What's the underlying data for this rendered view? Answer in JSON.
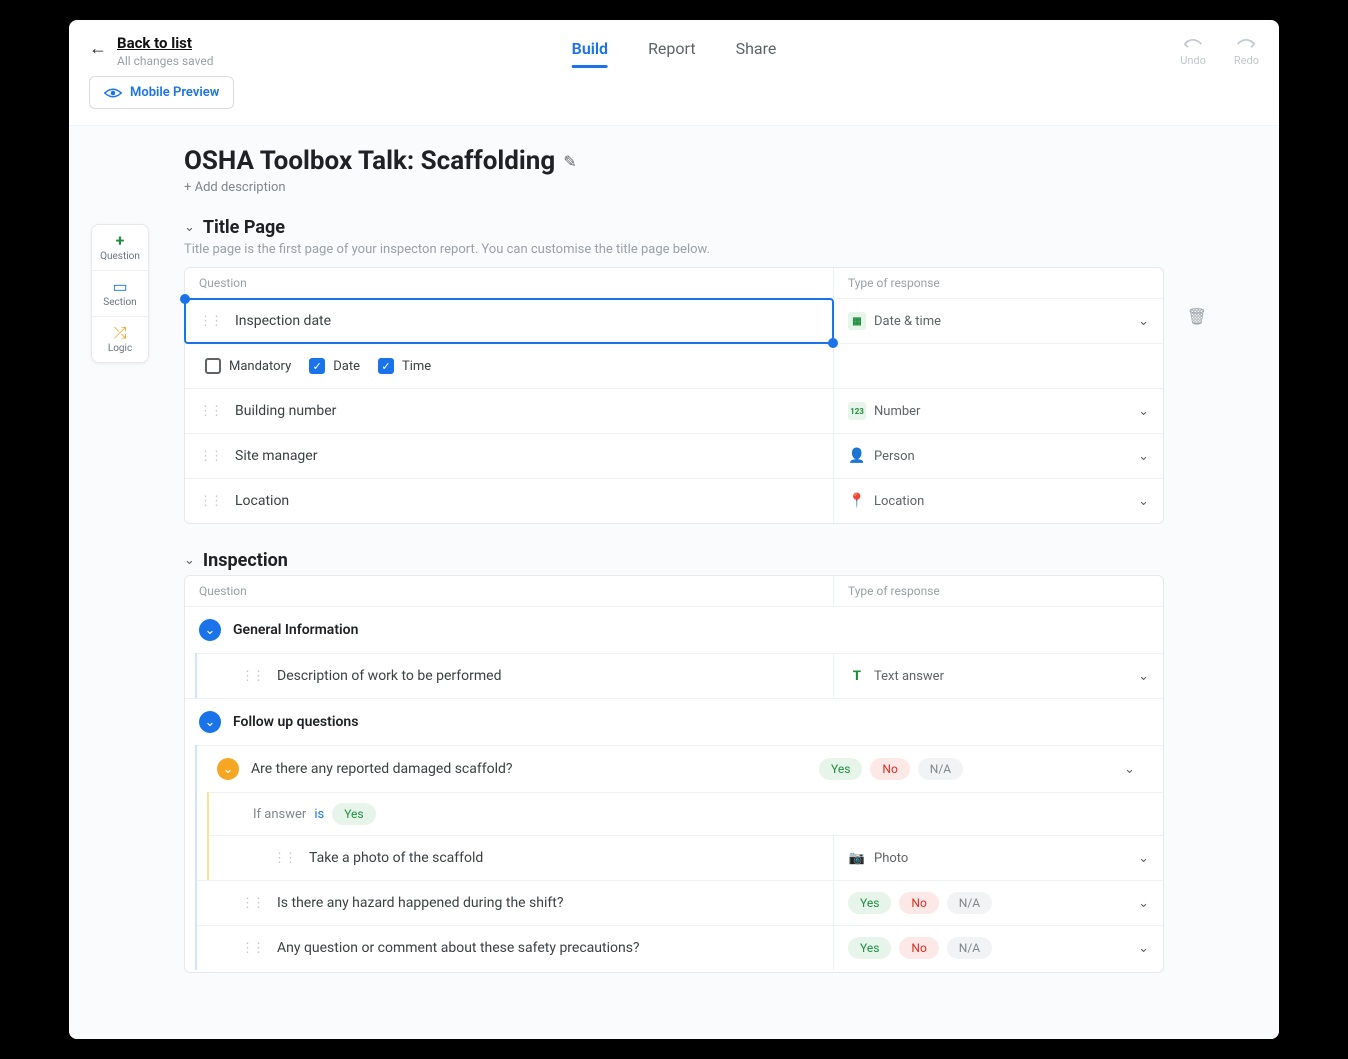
{
  "header": {
    "back_label": "Back to list",
    "saved_text": "All changes saved",
    "tabs": {
      "build": "Build",
      "report": "Report",
      "share": "Share"
    },
    "undo": "Undo",
    "redo": "Redo",
    "mobile_preview": "Mobile Preview"
  },
  "sidetools": {
    "question": "Question",
    "section": "Section",
    "logic": "Logic"
  },
  "template": {
    "title": "OSHA Toolbox Talk: Scaffolding",
    "add_description": "+ Add description"
  },
  "columns": {
    "question": "Question",
    "response": "Type of response"
  },
  "title_page": {
    "name": "Title Page",
    "hint": "Title page is the first page of your inspecton report. You can customise the title page below.",
    "rows": [
      {
        "label": "Inspection date",
        "response": "Date & time"
      },
      {
        "label": "Building number",
        "response": "Number"
      },
      {
        "label": "Site manager",
        "response": "Person"
      },
      {
        "label": "Location",
        "response": "Location"
      }
    ],
    "options": {
      "mandatory": "Mandatory",
      "date": "Date",
      "time": "Time"
    }
  },
  "inspection": {
    "name": "Inspection",
    "general_info": "General Information",
    "desc_work": "Description of work to be performed",
    "text_answer": "Text answer",
    "follow_up": "Follow up questions",
    "q_damaged": "Are there any reported damaged scaffold?",
    "logic_if": "If answer",
    "logic_is": "is",
    "logic_yes": "Yes",
    "q_photo": "Take a photo of the scaffold",
    "photo": "Photo",
    "q_hazard": "Is there any hazard happened during the shift?",
    "q_comment": "Any question or comment about these safety precautions?",
    "pills": {
      "yes": "Yes",
      "no": "No",
      "na": "N/A"
    }
  }
}
